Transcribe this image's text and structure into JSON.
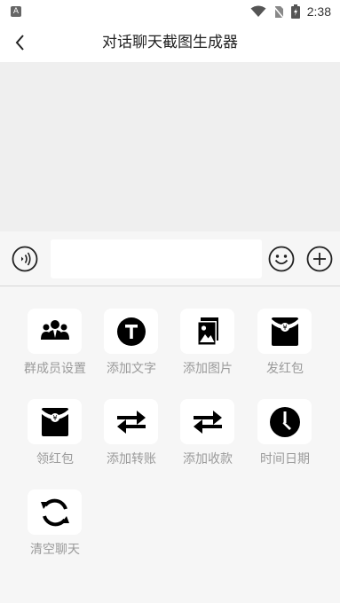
{
  "status_bar": {
    "time": "2:38"
  },
  "header": {
    "title": "对话聊天截图生成器"
  },
  "input_bar": {
    "placeholder": ""
  },
  "tools": [
    {
      "label": "群成员设置",
      "icon": "group-members-icon"
    },
    {
      "label": "添加文字",
      "icon": "text-t-icon"
    },
    {
      "label": "添加图片",
      "icon": "image-icon"
    },
    {
      "label": "发红包",
      "icon": "red-packet-icon"
    },
    {
      "label": "领红包",
      "icon": "red-packet-icon"
    },
    {
      "label": "添加转账",
      "icon": "transfer-arrows-icon"
    },
    {
      "label": "添加收款",
      "icon": "transfer-arrows-icon"
    },
    {
      "label": "时间日期",
      "icon": "clock-icon"
    },
    {
      "label": "清空聊天",
      "icon": "refresh-icon"
    }
  ],
  "colors": {
    "background": "#efefef",
    "panel": "#f6f6f6",
    "label": "#9a9a9a",
    "icon": "#000000"
  }
}
